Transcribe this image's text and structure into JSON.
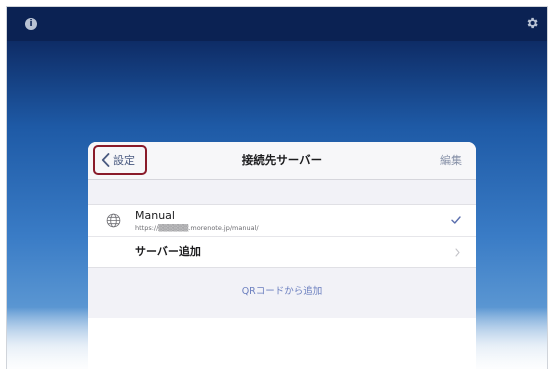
{
  "nav": {
    "back_label": "設定",
    "title": "接続先サーバー",
    "edit_label": "編集"
  },
  "servers": [
    {
      "name": "Manual",
      "url": "https://▒▒▒▒▒▒.morenote.jp/manual/",
      "selected": true
    }
  ],
  "add_server_label": "サーバー追加",
  "qr_add_label": "QRコードから追加",
  "icons": {
    "top_left": "info-icon",
    "top_right": "gear-icon",
    "server": "globe-icon",
    "selected": "checkmark-icon",
    "back": "chevron-left-icon",
    "add": "chevron-right-icon"
  },
  "colors": {
    "topbar": "#0b2253",
    "highlight_border": "#8a1b2a",
    "link": "#6b7fbf"
  }
}
